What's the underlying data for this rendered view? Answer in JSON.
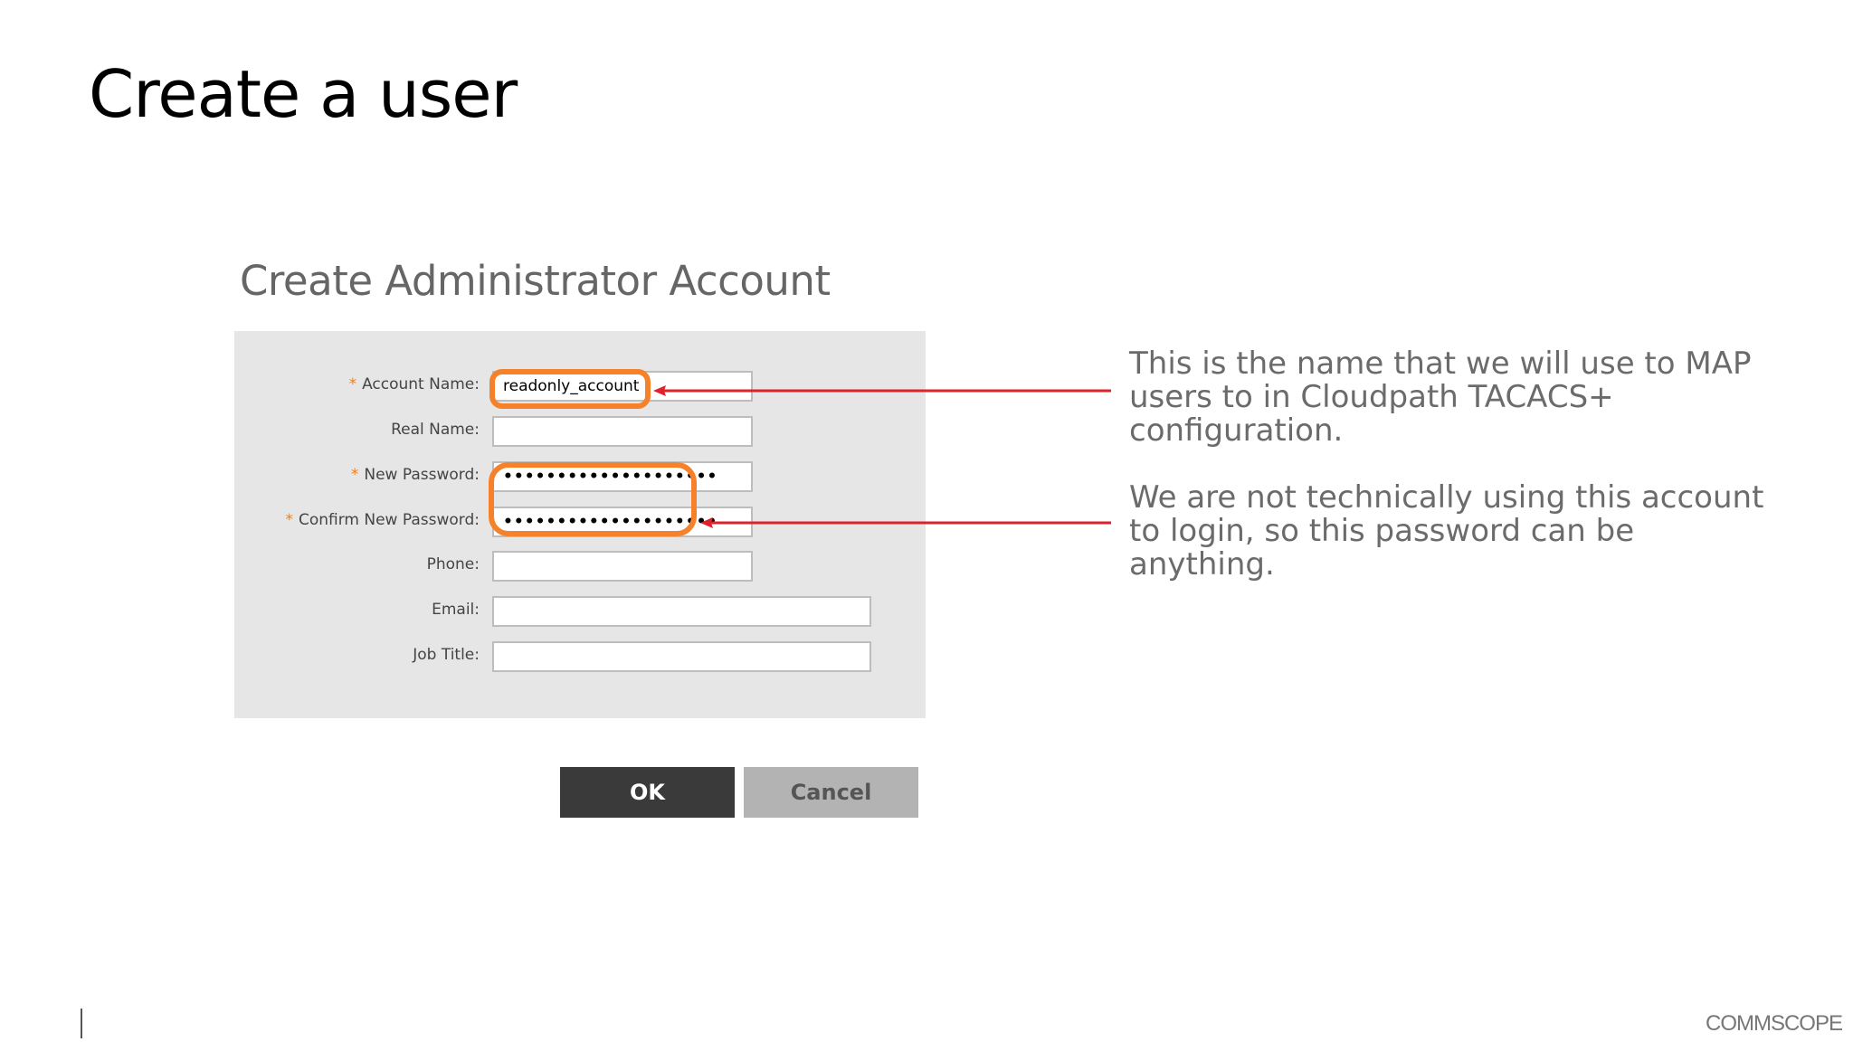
{
  "slide": {
    "title": "Create a user"
  },
  "dialog": {
    "heading": "Create Administrator Account",
    "fields": {
      "account_name": {
        "label": "Account Name:",
        "value": "readonly_account",
        "required": true
      },
      "real_name": {
        "label": "Real Name:",
        "value": ""
      },
      "new_password": {
        "label": "New Password:",
        "value": "••••••••••••••••••••",
        "required": true
      },
      "confirm_password": {
        "label": "Confirm New Password:",
        "value": "••••••••••••••••••••",
        "required": true
      },
      "phone": {
        "label": "Phone:",
        "value": ""
      },
      "email": {
        "label": "Email:",
        "value": ""
      },
      "job_title": {
        "label": "Job Title:",
        "value": ""
      }
    },
    "required_marker": "*",
    "buttons": {
      "ok": "OK",
      "cancel": "Cancel"
    }
  },
  "annotations": {
    "account_note": "This is the name that we will use to MAP users to in Cloudpath TACACS+ configuration.",
    "password_note": "We are not technically using this account to login, so this password can be anything."
  },
  "footer": {
    "brand": "COMMSCOPE"
  },
  "colors": {
    "highlight": "#f5822a",
    "arrow": "#e0202a",
    "ok_button": "#3a3a3a",
    "cancel_button": "#b3b3b3",
    "panel": "#e6e6e6"
  }
}
